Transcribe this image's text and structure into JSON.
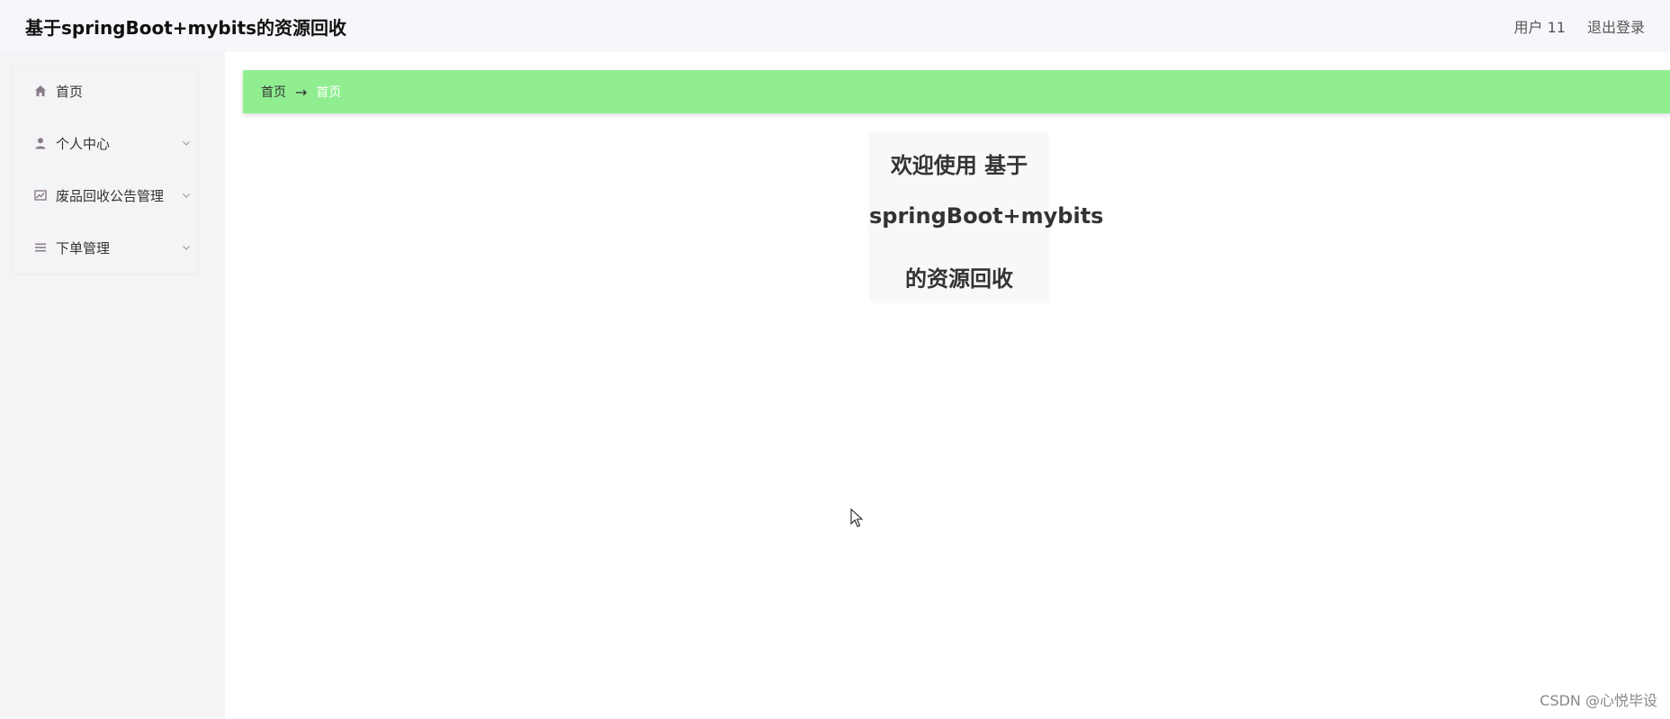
{
  "header": {
    "title": "基于springBoot+mybits的资源回收",
    "user_label": "用户 11",
    "logout_label": "退出登录"
  },
  "sidebar": {
    "items": [
      {
        "label": "首页",
        "icon": "home-icon",
        "has_submenu": false
      },
      {
        "label": "个人中心",
        "icon": "user-icon",
        "has_submenu": true
      },
      {
        "label": "废品回收公告管理",
        "icon": "chart-icon",
        "has_submenu": true
      },
      {
        "label": "下单管理",
        "icon": "list-icon",
        "has_submenu": true
      }
    ]
  },
  "breadcrumb": {
    "first": "首页",
    "separator": "→",
    "current": "首页"
  },
  "welcome": {
    "line1": "欢迎使用 基于",
    "line2": "springBoot+mybits",
    "line3": "的资源回收"
  },
  "watermark": "CSDN @心悦毕设",
  "colors": {
    "breadcrumb_bg": "#90ee90",
    "sidebar_bg": "#f4f4f7",
    "header_bg": "#f7f6fa",
    "icon_color": "#8c7b8a"
  }
}
